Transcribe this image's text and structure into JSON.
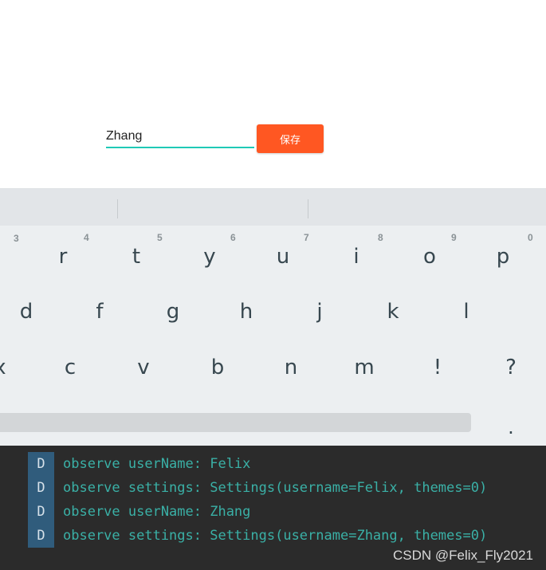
{
  "app": {
    "name_input_value": "Zhang",
    "save_label": "保存"
  },
  "keyboard": {
    "row1": [
      {
        "key": "r",
        "hint": "3"
      },
      {
        "key": "t",
        "hint": "4"
      },
      {
        "key": "y",
        "hint": "5"
      },
      {
        "key": "u",
        "hint": "6"
      },
      {
        "key": "i",
        "hint": "7"
      },
      {
        "key": "o",
        "hint": "8"
      },
      {
        "key": "p",
        "hint": "9"
      },
      {
        "key": "",
        "hint": "0"
      }
    ],
    "row2": [
      "d",
      "f",
      "g",
      "h",
      "j",
      "k",
      "l"
    ],
    "row3": [
      "x",
      "c",
      "v",
      "b",
      "n",
      "m",
      "!",
      "?"
    ],
    "period": "."
  },
  "logcat": {
    "entries": [
      {
        "level": "D",
        "message": "observe userName: Felix"
      },
      {
        "level": "D",
        "message": "observe settings: Settings(username=Felix, themes=0)"
      },
      {
        "level": "D",
        "message": "observe userName: Zhang"
      },
      {
        "level": "D",
        "message": "observe settings: Settings(username=Zhang, themes=0)"
      }
    ],
    "watermark": "CSDN @Felix_Fly2021"
  },
  "colors": {
    "accent_underline": "#1fc9b6",
    "save_button": "#ff5722",
    "console_bg": "#2b2b2b",
    "log_text": "#3ab0a6",
    "level_badge": "#305c7c"
  }
}
